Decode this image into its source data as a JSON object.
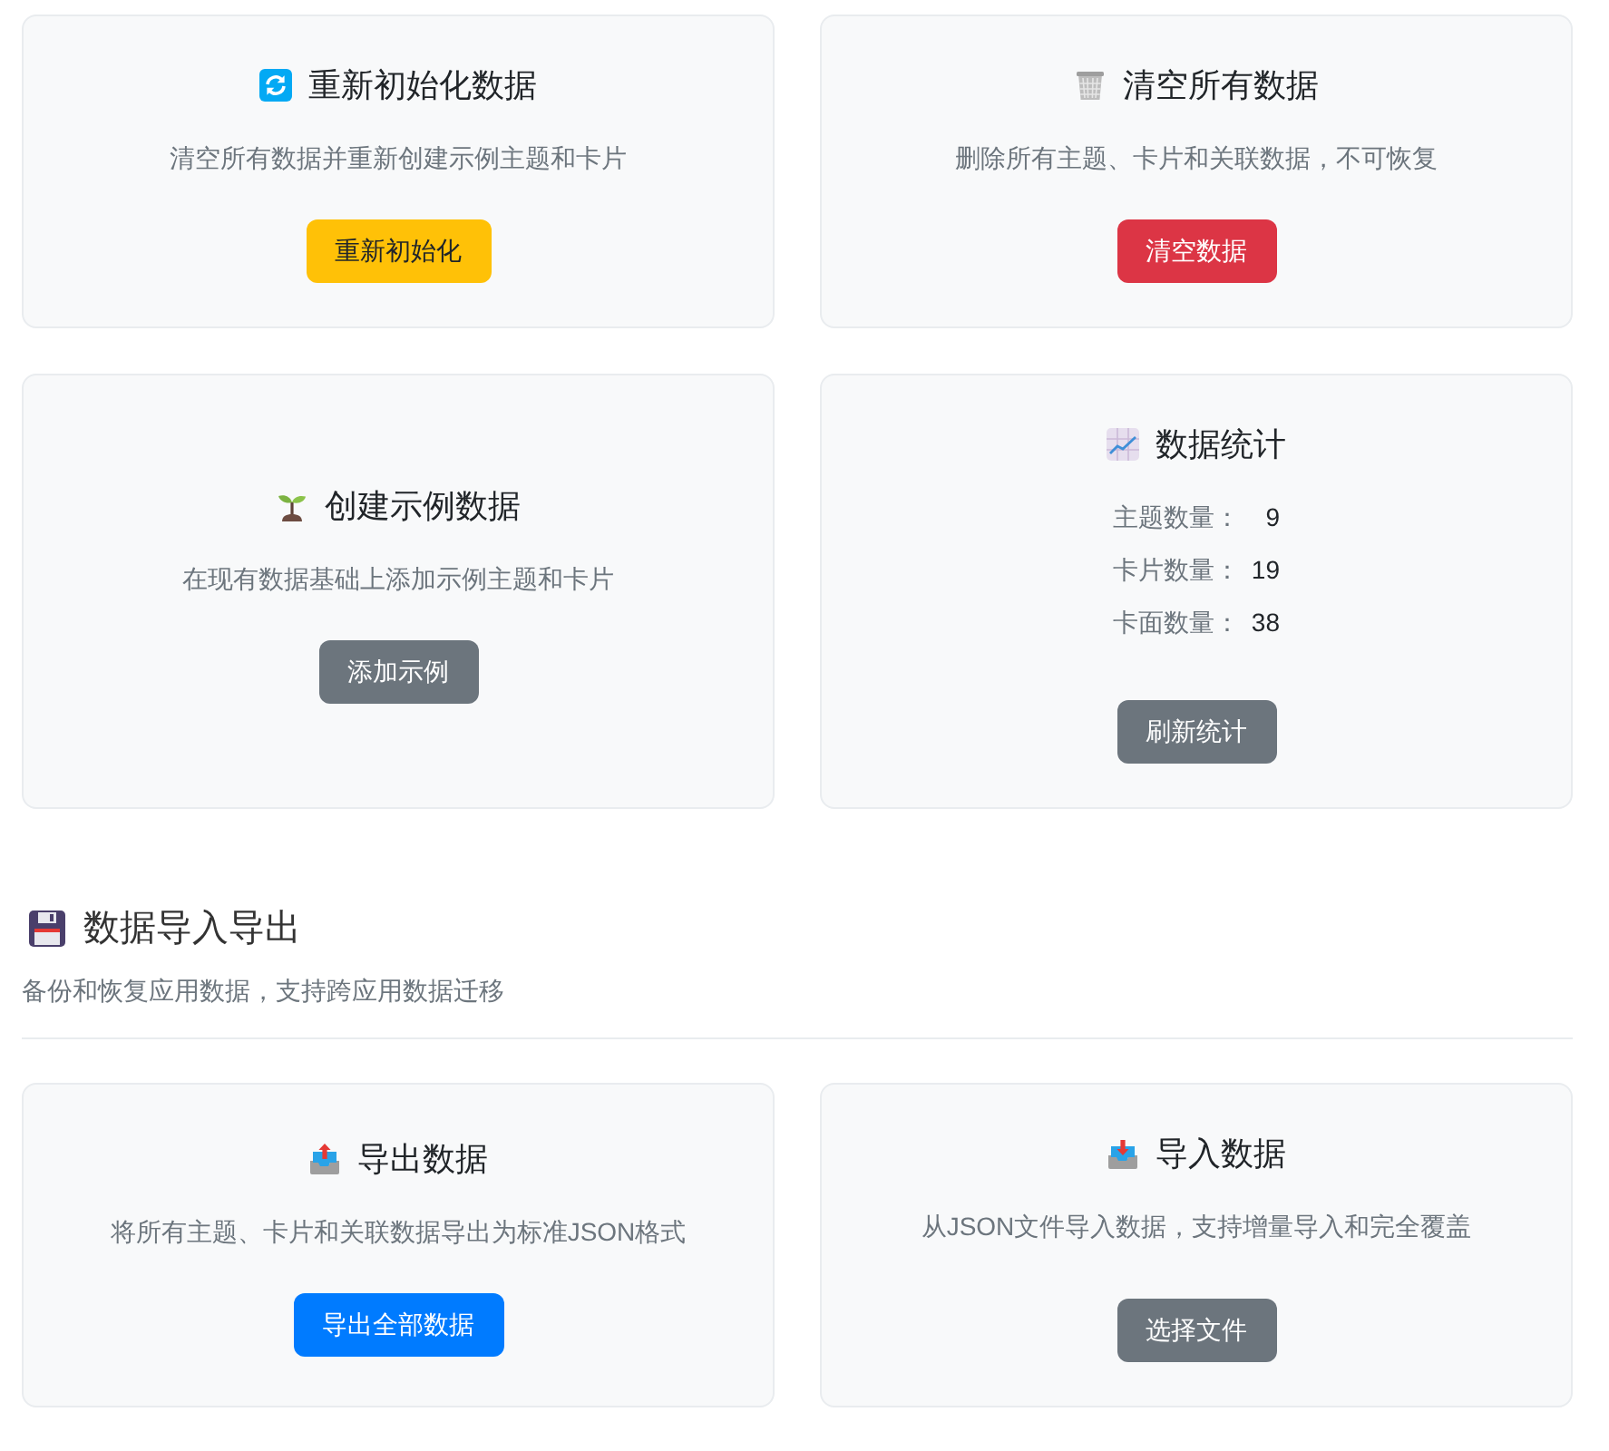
{
  "card_rows": [
    {
      "cards": [
        {
          "kind": "action",
          "title": "重新初始化数据",
          "description": "清空所有数据并重新创建示例主题和卡片",
          "button": {
            "label": "重新初始化",
            "color": "#ffc107"
          }
        },
        {
          "kind": "action",
          "title": "清空所有数据",
          "description": "删除所有主题、卡片和关联数据，不可恢复",
          "button": {
            "label": "清空数据",
            "color": "#dc3545"
          }
        }
      ]
    },
    {
      "cards": [
        {
          "kind": "action",
          "title": "创建示例数据",
          "description": "在现有数据基础上添加示例主题和卡片",
          "button": {
            "label": "添加示例",
            "color": "#6c757d"
          }
        },
        {
          "kind": "stats",
          "title": "数据统计",
          "stats": [
            {
              "label": "主题数量：",
              "value": "9"
            },
            {
              "label": "卡片数量：",
              "value": "19"
            },
            {
              "label": "卡面数量：",
              "value": "38"
            }
          ],
          "button": {
            "label": "刷新统计",
            "color": "#6c757d"
          }
        }
      ]
    }
  ],
  "import_export": {
    "title": "数据导入导出",
    "subtitle": "备份和恢复应用数据，支持跨应用数据迁移",
    "cards": [
      {
        "kind": "action",
        "title": "导出数据",
        "description": "将所有主题、卡片和关联数据导出为标准JSON格式",
        "button": {
          "label": "导出全部数据",
          "color": "#007bff"
        }
      },
      {
        "kind": "file",
        "title": "导入数据",
        "description": "从JSON文件导入数据，支持增量导入和完全覆盖",
        "button": {
          "label": "选择文件",
          "color": "#6c757d"
        }
      }
    ]
  }
}
